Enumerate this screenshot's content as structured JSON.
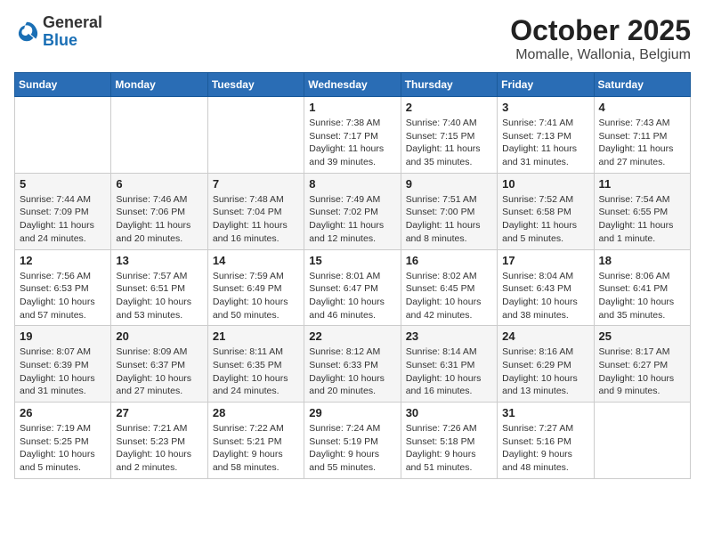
{
  "logo": {
    "general": "General",
    "blue": "Blue"
  },
  "title": "October 2025",
  "location": "Momalle, Wallonia, Belgium",
  "weekdays": [
    "Sunday",
    "Monday",
    "Tuesday",
    "Wednesday",
    "Thursday",
    "Friday",
    "Saturday"
  ],
  "days": [
    {
      "date": "",
      "info": ""
    },
    {
      "date": "",
      "info": ""
    },
    {
      "date": "",
      "info": ""
    },
    {
      "date": "1",
      "info": "Sunrise: 7:38 AM\nSunset: 7:17 PM\nDaylight: 11 hours\nand 39 minutes."
    },
    {
      "date": "2",
      "info": "Sunrise: 7:40 AM\nSunset: 7:15 PM\nDaylight: 11 hours\nand 35 minutes."
    },
    {
      "date": "3",
      "info": "Sunrise: 7:41 AM\nSunset: 7:13 PM\nDaylight: 11 hours\nand 31 minutes."
    },
    {
      "date": "4",
      "info": "Sunrise: 7:43 AM\nSunset: 7:11 PM\nDaylight: 11 hours\nand 27 minutes."
    },
    {
      "date": "5",
      "info": "Sunrise: 7:44 AM\nSunset: 7:09 PM\nDaylight: 11 hours\nand 24 minutes."
    },
    {
      "date": "6",
      "info": "Sunrise: 7:46 AM\nSunset: 7:06 PM\nDaylight: 11 hours\nand 20 minutes."
    },
    {
      "date": "7",
      "info": "Sunrise: 7:48 AM\nSunset: 7:04 PM\nDaylight: 11 hours\nand 16 minutes."
    },
    {
      "date": "8",
      "info": "Sunrise: 7:49 AM\nSunset: 7:02 PM\nDaylight: 11 hours\nand 12 minutes."
    },
    {
      "date": "9",
      "info": "Sunrise: 7:51 AM\nSunset: 7:00 PM\nDaylight: 11 hours\nand 8 minutes."
    },
    {
      "date": "10",
      "info": "Sunrise: 7:52 AM\nSunset: 6:58 PM\nDaylight: 11 hours\nand 5 minutes."
    },
    {
      "date": "11",
      "info": "Sunrise: 7:54 AM\nSunset: 6:55 PM\nDaylight: 11 hours\nand 1 minute."
    },
    {
      "date": "12",
      "info": "Sunrise: 7:56 AM\nSunset: 6:53 PM\nDaylight: 10 hours\nand 57 minutes."
    },
    {
      "date": "13",
      "info": "Sunrise: 7:57 AM\nSunset: 6:51 PM\nDaylight: 10 hours\nand 53 minutes."
    },
    {
      "date": "14",
      "info": "Sunrise: 7:59 AM\nSunset: 6:49 PM\nDaylight: 10 hours\nand 50 minutes."
    },
    {
      "date": "15",
      "info": "Sunrise: 8:01 AM\nSunset: 6:47 PM\nDaylight: 10 hours\nand 46 minutes."
    },
    {
      "date": "16",
      "info": "Sunrise: 8:02 AM\nSunset: 6:45 PM\nDaylight: 10 hours\nand 42 minutes."
    },
    {
      "date": "17",
      "info": "Sunrise: 8:04 AM\nSunset: 6:43 PM\nDaylight: 10 hours\nand 38 minutes."
    },
    {
      "date": "18",
      "info": "Sunrise: 8:06 AM\nSunset: 6:41 PM\nDaylight: 10 hours\nand 35 minutes."
    },
    {
      "date": "19",
      "info": "Sunrise: 8:07 AM\nSunset: 6:39 PM\nDaylight: 10 hours\nand 31 minutes."
    },
    {
      "date": "20",
      "info": "Sunrise: 8:09 AM\nSunset: 6:37 PM\nDaylight: 10 hours\nand 27 minutes."
    },
    {
      "date": "21",
      "info": "Sunrise: 8:11 AM\nSunset: 6:35 PM\nDaylight: 10 hours\nand 24 minutes."
    },
    {
      "date": "22",
      "info": "Sunrise: 8:12 AM\nSunset: 6:33 PM\nDaylight: 10 hours\nand 20 minutes."
    },
    {
      "date": "23",
      "info": "Sunrise: 8:14 AM\nSunset: 6:31 PM\nDaylight: 10 hours\nand 16 minutes."
    },
    {
      "date": "24",
      "info": "Sunrise: 8:16 AM\nSunset: 6:29 PM\nDaylight: 10 hours\nand 13 minutes."
    },
    {
      "date": "25",
      "info": "Sunrise: 8:17 AM\nSunset: 6:27 PM\nDaylight: 10 hours\nand 9 minutes."
    },
    {
      "date": "26",
      "info": "Sunrise: 7:19 AM\nSunset: 5:25 PM\nDaylight: 10 hours\nand 5 minutes."
    },
    {
      "date": "27",
      "info": "Sunrise: 7:21 AM\nSunset: 5:23 PM\nDaylight: 10 hours\nand 2 minutes."
    },
    {
      "date": "28",
      "info": "Sunrise: 7:22 AM\nSunset: 5:21 PM\nDaylight: 9 hours\nand 58 minutes."
    },
    {
      "date": "29",
      "info": "Sunrise: 7:24 AM\nSunset: 5:19 PM\nDaylight: 9 hours\nand 55 minutes."
    },
    {
      "date": "30",
      "info": "Sunrise: 7:26 AM\nSunset: 5:18 PM\nDaylight: 9 hours\nand 51 minutes."
    },
    {
      "date": "31",
      "info": "Sunrise: 7:27 AM\nSunset: 5:16 PM\nDaylight: 9 hours\nand 48 minutes."
    },
    {
      "date": "",
      "info": ""
    }
  ]
}
